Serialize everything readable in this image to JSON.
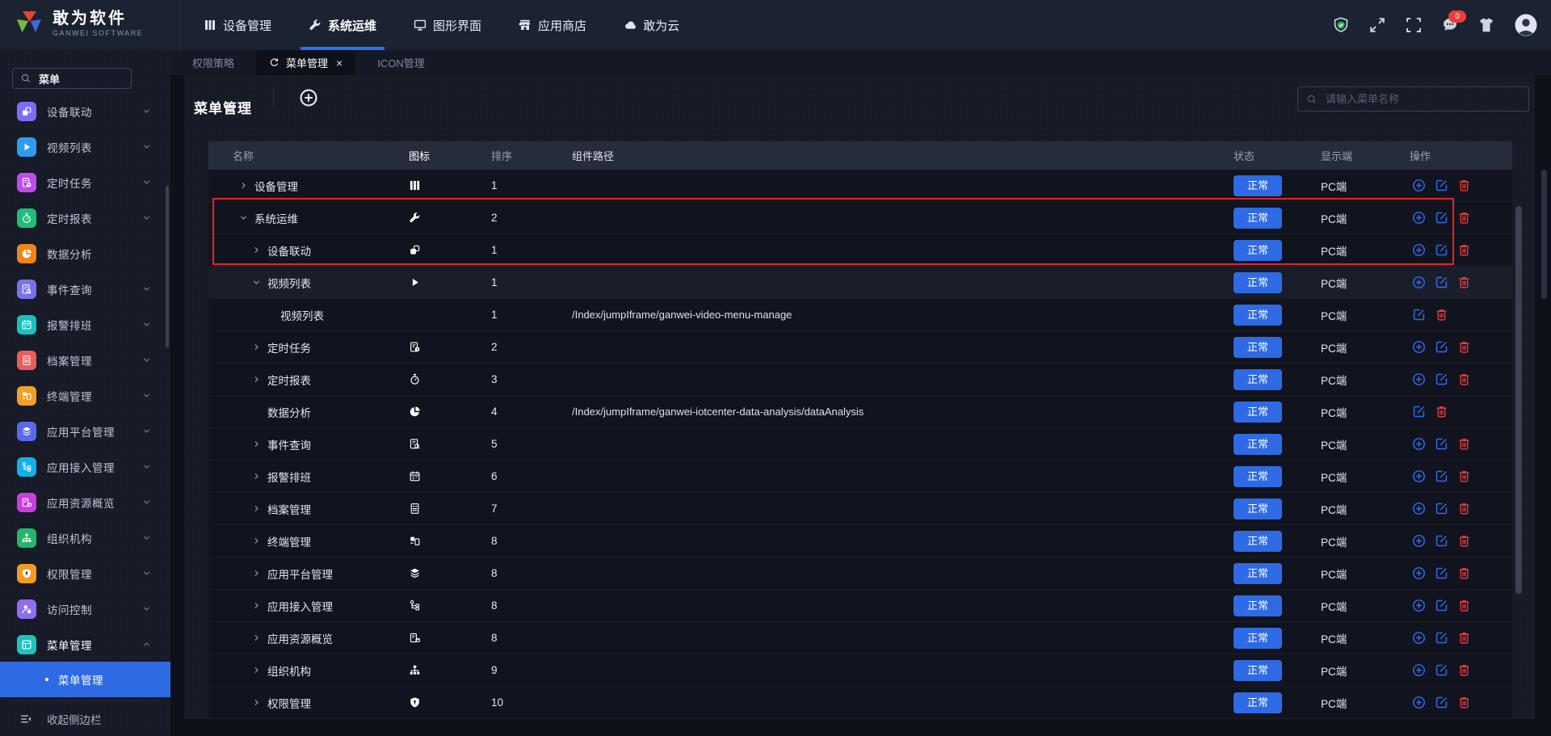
{
  "topbar": {
    "logo": {
      "title": "敢为软件",
      "subtitle": "GANWEI SOFTWARE"
    },
    "nav": [
      {
        "label": "设备管理",
        "icon": "grid",
        "active": false
      },
      {
        "label": "系统运维",
        "icon": "wrench",
        "active": true
      },
      {
        "label": "图形界面",
        "icon": "monitor",
        "active": false
      },
      {
        "label": "应用商店",
        "icon": "store",
        "active": false
      },
      {
        "label": "敢为云",
        "icon": "cloud",
        "active": false
      }
    ],
    "right_icons": [
      {
        "icon": "shield-check"
      },
      {
        "icon": "fullscreen"
      },
      {
        "icon": "frame"
      },
      {
        "icon": "chat",
        "badge": "0"
      },
      {
        "icon": "shirt"
      },
      {
        "icon": "avatar"
      }
    ]
  },
  "sidebar": {
    "search": {
      "value": "菜单",
      "icon": "search"
    },
    "items": [
      {
        "label": "设备联动",
        "icon": "linkage",
        "color": "#7b6ef6",
        "chevron": "down"
      },
      {
        "label": "视频列表",
        "icon": "play",
        "color": "#2f9bf0",
        "chevron": "down"
      },
      {
        "label": "定时任务",
        "icon": "task",
        "color": "#bf4bee",
        "chevron": "down"
      },
      {
        "label": "定时报表",
        "icon": "stopwatch",
        "color": "#22bd7a",
        "chevron": "down"
      },
      {
        "label": "数据分析",
        "icon": "pie",
        "color": "#f08519",
        "chevron": null
      },
      {
        "label": "事件查询",
        "icon": "event",
        "color": "#7a72e9",
        "chevron": "down"
      },
      {
        "label": "报警排班",
        "icon": "calendar",
        "color": "#16c2bf",
        "chevron": "down"
      },
      {
        "label": "档案管理",
        "icon": "idcard",
        "color": "#ee5b5b",
        "chevron": "down"
      },
      {
        "label": "终端管理",
        "icon": "terminal",
        "color": "#eea02b",
        "chevron": "down"
      },
      {
        "label": "应用平台管理",
        "icon": "layers",
        "color": "#5a68ea",
        "chevron": "down"
      },
      {
        "label": "应用接入管理",
        "icon": "access",
        "color": "#14aee8",
        "chevron": "down"
      },
      {
        "label": "应用资源概览",
        "icon": "resource",
        "color": "#c93ee0",
        "chevron": "down"
      },
      {
        "label": "组织机构",
        "icon": "org",
        "color": "#27b567",
        "chevron": "down"
      },
      {
        "label": "权限管理",
        "icon": "shield",
        "color": "#f59a23",
        "chevron": "down"
      },
      {
        "label": "访问控制",
        "icon": "user-lock",
        "color": "#8f6cf0",
        "chevron": "down"
      },
      {
        "label": "菜单管理",
        "icon": "menu-layout",
        "color": "#1ec2c0",
        "chevron": "up",
        "open": true
      }
    ],
    "active_subitem": "菜单管理",
    "collapse_label": "收起侧边栏"
  },
  "tabs": [
    {
      "label": "权限策略",
      "active": false
    },
    {
      "label": "菜单管理",
      "active": true,
      "refresh_icon": "refresh",
      "closable": true
    },
    {
      "label": "ICON管理",
      "active": false
    }
  ],
  "page": {
    "title": "菜单管理",
    "add_icon": "plus-circle",
    "search_placeholder": "请输入菜单名称"
  },
  "table": {
    "columns": [
      "名称",
      "图标",
      "排序",
      "组件路径",
      "状态",
      "显示端",
      "操作"
    ],
    "rows": [
      {
        "name": "设备管理",
        "level": 1,
        "expand": "collapsed",
        "icon": "grid",
        "sort": "1",
        "path": "",
        "status": "正常",
        "display": "PC端",
        "actions": [
          "add",
          "edit",
          "delete"
        ],
        "highlight": false
      },
      {
        "name": "系统运维",
        "level": 1,
        "expand": "expanded",
        "icon": "wrench",
        "sort": "2",
        "path": "",
        "status": "正常",
        "display": "PC端",
        "actions": [
          "add",
          "edit",
          "delete"
        ],
        "highlight": false
      },
      {
        "name": "设备联动",
        "level": 2,
        "expand": "collapsed",
        "icon": "linkage",
        "sort": "1",
        "path": "",
        "status": "正常",
        "display": "PC端",
        "actions": [
          "add",
          "edit",
          "delete"
        ],
        "highlight": false
      },
      {
        "name": "视频列表",
        "level": 2,
        "expand": "expanded",
        "icon": "play",
        "sort": "1",
        "path": "",
        "status": "正常",
        "display": "PC端",
        "actions": [
          "add",
          "edit",
          "delete"
        ],
        "highlight": true
      },
      {
        "name": "视频列表",
        "level": 3,
        "expand": "none",
        "icon": "",
        "sort": "1",
        "path": "/Index/jumpIframe/ganwei-video-menu-manage",
        "status": "正常",
        "display": "PC端",
        "actions": [
          "edit",
          "delete"
        ],
        "highlight": false
      },
      {
        "name": "定时任务",
        "level": 2,
        "expand": "collapsed",
        "icon": "task",
        "sort": "2",
        "path": "",
        "status": "正常",
        "display": "PC端",
        "actions": [
          "add",
          "edit",
          "delete"
        ],
        "highlight": false
      },
      {
        "name": "定时报表",
        "level": 2,
        "expand": "collapsed",
        "icon": "stopwatch",
        "sort": "3",
        "path": "",
        "status": "正常",
        "display": "PC端",
        "actions": [
          "add",
          "edit",
          "delete"
        ],
        "highlight": false
      },
      {
        "name": "数据分析",
        "level": 2,
        "expand": "none",
        "icon": "pie",
        "sort": "4",
        "path": "/Index/jumpIframe/ganwei-iotcenter-data-analysis/dataAnalysis",
        "status": "正常",
        "display": "PC端",
        "actions": [
          "edit",
          "delete"
        ],
        "highlight": false
      },
      {
        "name": "事件查询",
        "level": 2,
        "expand": "collapsed",
        "icon": "event",
        "sort": "5",
        "path": "",
        "status": "正常",
        "display": "PC端",
        "actions": [
          "add",
          "edit",
          "delete"
        ],
        "highlight": false
      },
      {
        "name": "报警排班",
        "level": 2,
        "expand": "collapsed",
        "icon": "calendar",
        "sort": "6",
        "path": "",
        "status": "正常",
        "display": "PC端",
        "actions": [
          "add",
          "edit",
          "delete"
        ],
        "highlight": false
      },
      {
        "name": "档案管理",
        "level": 2,
        "expand": "collapsed",
        "icon": "idcard",
        "sort": "7",
        "path": "",
        "status": "正常",
        "display": "PC端",
        "actions": [
          "add",
          "edit",
          "delete"
        ],
        "highlight": false
      },
      {
        "name": "终端管理",
        "level": 2,
        "expand": "collapsed",
        "icon": "terminal",
        "sort": "8",
        "path": "",
        "status": "正常",
        "display": "PC端",
        "actions": [
          "add",
          "edit",
          "delete"
        ],
        "highlight": false
      },
      {
        "name": "应用平台管理",
        "level": 2,
        "expand": "collapsed",
        "icon": "layers",
        "sort": "8",
        "path": "",
        "status": "正常",
        "display": "PC端",
        "actions": [
          "add",
          "edit",
          "delete"
        ],
        "highlight": false
      },
      {
        "name": "应用接入管理",
        "level": 2,
        "expand": "collapsed",
        "icon": "access",
        "sort": "8",
        "path": "",
        "status": "正常",
        "display": "PC端",
        "actions": [
          "add",
          "edit",
          "delete"
        ],
        "highlight": false
      },
      {
        "name": "应用资源概览",
        "level": 2,
        "expand": "collapsed",
        "icon": "resource",
        "sort": "8",
        "path": "",
        "status": "正常",
        "display": "PC端",
        "actions": [
          "add",
          "edit",
          "delete"
        ],
        "highlight": false
      },
      {
        "name": "组织机构",
        "level": 2,
        "expand": "collapsed",
        "icon": "org",
        "sort": "9",
        "path": "",
        "status": "正常",
        "display": "PC端",
        "actions": [
          "add",
          "edit",
          "delete"
        ],
        "highlight": false
      },
      {
        "name": "权限管理",
        "level": 2,
        "expand": "collapsed",
        "icon": "shield",
        "sort": "10",
        "path": "",
        "status": "正常",
        "display": "PC端",
        "actions": [
          "add",
          "edit",
          "delete"
        ],
        "highlight": false
      }
    ]
  },
  "colors": {
    "accent_blue": "#2e6ae3",
    "nav_underline": "#2f6df6",
    "danger_red": "#e23c3c",
    "highlight_border_red": "#e8261d",
    "badge_bg": "#2e6ae3"
  }
}
